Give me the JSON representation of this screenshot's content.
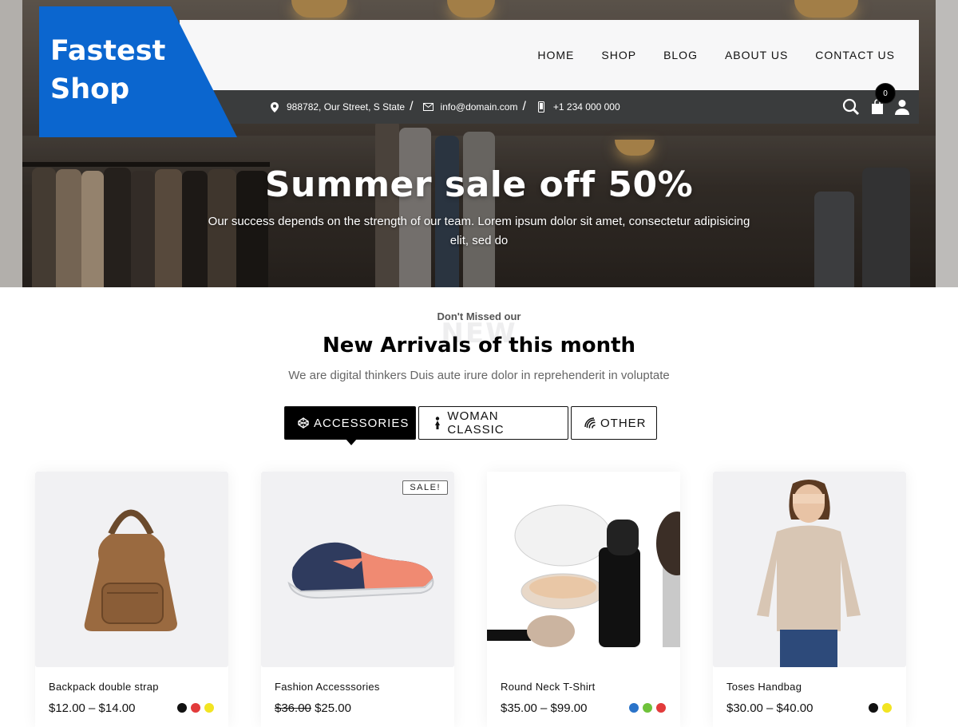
{
  "brand": {
    "line1": "Fastest",
    "line2": "Shop",
    "color": "#0b66cf"
  },
  "nav": {
    "items": [
      "HOME",
      "SHOP",
      "BLOG",
      "ABOUT US",
      "CONTACT US"
    ]
  },
  "info": {
    "address": "988782, Our Street, S State",
    "email": "info@domain.com",
    "phone": "+1 234 000 000",
    "separator": "/",
    "cart_count": "0"
  },
  "hero": {
    "title": "Summer sale off 50%",
    "subtitle": "Our success depends on the strength of our team. Lorem ipsum dolor sit amet, consectetur adipisicing elit, sed do"
  },
  "section": {
    "kicker": "Don't Missed our",
    "ghost": "NEW",
    "title": "New Arrivals of this month",
    "subtitle": "We are digital thinkers Duis aute irure dolor in reprehenderit in voluptate"
  },
  "tabs": [
    {
      "label": "ACCESSORIES",
      "icon": "codepen-icon",
      "active": true
    },
    {
      "label": "WOMAN CLASSIC",
      "icon": "woman-icon",
      "active": false
    },
    {
      "label": "OTHER",
      "icon": "striped-circle-icon",
      "active": false
    }
  ],
  "products": [
    {
      "name": "Backpack double strap",
      "price": "$12.00 – $14.00",
      "old_price": "",
      "swatches": [
        "#111111",
        "#e23b3b",
        "#f2e422"
      ],
      "sale": ""
    },
    {
      "name": "Fashion Accesssories",
      "price": "$25.00",
      "old_price": "$36.00",
      "swatches": [],
      "sale": "SALE!"
    },
    {
      "name": "Round Neck T-Shirt",
      "price": "$35.00 – $99.00",
      "old_price": "",
      "swatches": [
        "#2a73c9",
        "#6fc23a",
        "#e23b3b"
      ],
      "sale": ""
    },
    {
      "name": "Toses Handbag",
      "price": "$30.00 – $40.00",
      "old_price": "",
      "swatches": [
        "#111111",
        "#f2e422"
      ],
      "sale": ""
    }
  ]
}
